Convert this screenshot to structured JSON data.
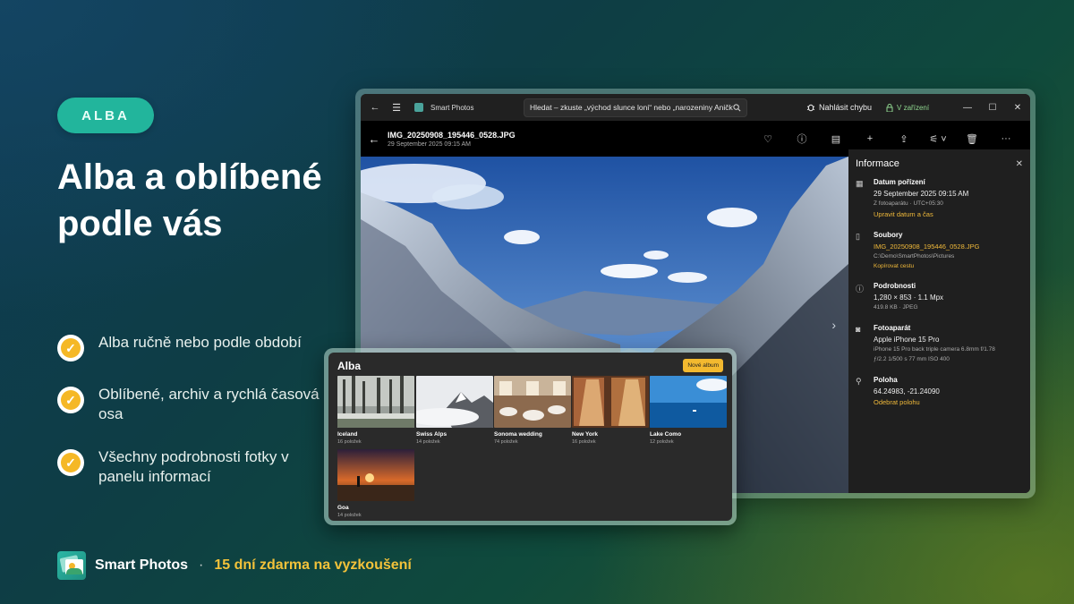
{
  "promo": {
    "badge": "ALBA",
    "headline": "Alba a oblíbené podle vás",
    "features": [
      "Alba ručně nebo podle období",
      "Oblíbené, archiv a rychlá časová osa",
      "Všechny podrobnosti fotky v panelu informací"
    ],
    "brand": "Smart Photos",
    "separator": "·",
    "trial": "15 dní zdarma na vyzkoušení"
  },
  "window": {
    "app_title": "Smart Photos",
    "search_placeholder": "Hledat – zkuste „východ slunce loni“ nebo „narozeniny Aničky“",
    "report_bug": "Nahlásit chybu",
    "device": "V zařízení",
    "file_name": "IMG_20250908_195446_0528.JPG",
    "file_date": "29 September 2025 09:15 AM"
  },
  "info": {
    "title": "Informace",
    "date_title": "Datum pořízení",
    "date_value": "29 September 2025 09:15 AM",
    "date_sub": "Z fotoaparátu · UTC+05:30",
    "date_link": "Upravit datum a čas",
    "files_title": "Soubory",
    "files_name": "IMG_20250908_195446_0528.JPG",
    "files_path": "C:\\Demo\\SmartPhotos\\Pictures",
    "files_link": "Kopírovat cestu",
    "details_title": "Podrobnosti",
    "details_value": "1,280 × 853 · 1.1 Mpx",
    "details_sub": "419.8 KB · JPEG",
    "camera_title": "Fotoaparát",
    "camera_value": "Apple iPhone 15 Pro",
    "camera_sub1": "iPhone 15 Pro back triple camera 6.8mm f/1.78",
    "camera_sub2": "ƒ/2.2   1/500 s   77 mm   ISO 400",
    "location_title": "Poloha",
    "location_value": "64.24983, -21.24090",
    "location_link": "Odebrat polohu"
  },
  "albums": {
    "title": "Alba",
    "new_button": "Nové album",
    "items": [
      {
        "name": "Iceland",
        "count": "16 položek"
      },
      {
        "name": "Swiss Alps",
        "count": "14 položek"
      },
      {
        "name": "Sonoma wedding",
        "count": "74 položek"
      },
      {
        "name": "New York",
        "count": "16 položek"
      },
      {
        "name": "Lake Como",
        "count": "12 položek"
      },
      {
        "name": "Goa",
        "count": "14 položek"
      }
    ]
  },
  "colors": {
    "accent": "#f3b92f",
    "badge": "#22b59c"
  }
}
